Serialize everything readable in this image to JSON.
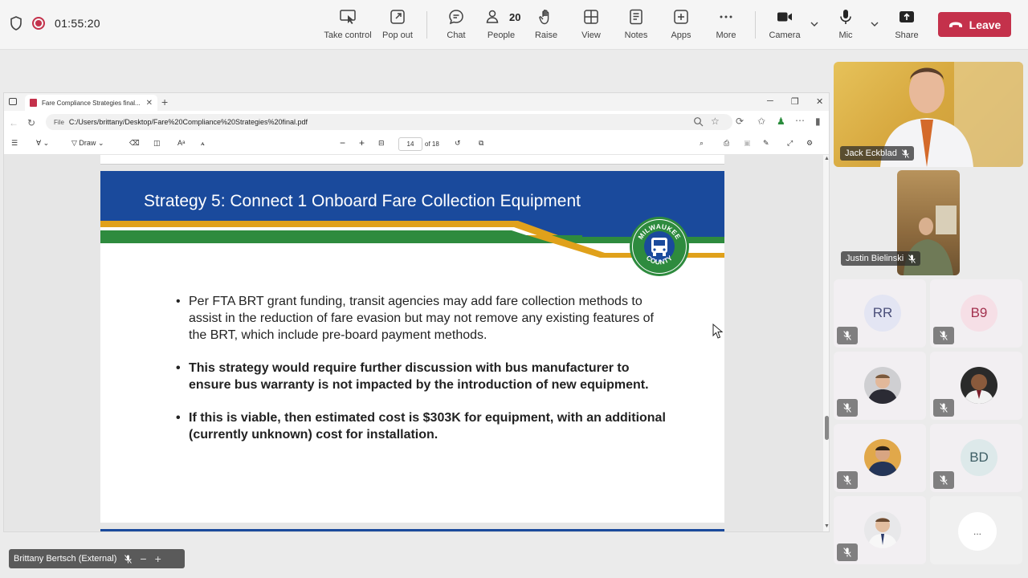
{
  "topbar": {
    "timer": "01:55:20",
    "buttons": {
      "take_control": "Take control",
      "pop_out": "Pop out",
      "chat": "Chat",
      "people": "People",
      "people_count": "20",
      "raise": "Raise",
      "view": "View",
      "notes": "Notes",
      "apps": "Apps",
      "more": "More",
      "camera": "Camera",
      "mic": "Mic",
      "share": "Share",
      "leave": "Leave"
    },
    "leave_color": "#c4314b"
  },
  "browser": {
    "tab_title": "Fare Compliance Strategies final...",
    "file_chip": "File",
    "url": "C:/Users/brittany/Desktop/Fare%20Compliance%20Strategies%20final.pdf",
    "pdf_toolbar": {
      "draw_label": "Draw",
      "page_current": "14",
      "page_total": "of 18"
    }
  },
  "slide": {
    "title": "Strategy 5: Connect 1 Onboard Fare Collection Equipment",
    "logo_text_top": "MILWAUKEE",
    "logo_text_bottom": "COUNTY",
    "bullets": [
      "Per FTA BRT grant funding, transit agencies may add fare collection methods to assist in the reduction of fare evasion but may not remove any existing features of the BRT, which include pre-board payment methods.",
      "This strategy would require further discussion with bus manufacturer to ensure bus warranty is not impacted by the introduction of new equipment.",
      "If this is viable, then estimated cost is $303K for equipment, with an additional (currently unknown) cost for installation."
    ],
    "colors": {
      "header_blue": "#1a4a9c",
      "stripe_gold": "#e0a11b",
      "stripe_green": "#2e8b3e"
    }
  },
  "participants": {
    "video_tiles": [
      {
        "name": "Jack Eckblad"
      },
      {
        "name": "Justin Bielinski"
      }
    ],
    "tiles": [
      {
        "initials": "RR",
        "color": "#e6e9f3",
        "text_color": "#4a4f7a"
      },
      {
        "initials": "B9",
        "color": "#f5e3e9",
        "text_color": "#a3324f"
      },
      {
        "initials": "",
        "kind": "photo"
      },
      {
        "initials": "",
        "kind": "photo"
      },
      {
        "initials": "",
        "kind": "photo"
      },
      {
        "initials": "BD",
        "color": "#e1ecec",
        "text_color": "#3f5f66"
      },
      {
        "initials": "",
        "kind": "photo"
      }
    ],
    "more": "..."
  },
  "self_view": {
    "name": "Brittany Bertsch (External)"
  }
}
